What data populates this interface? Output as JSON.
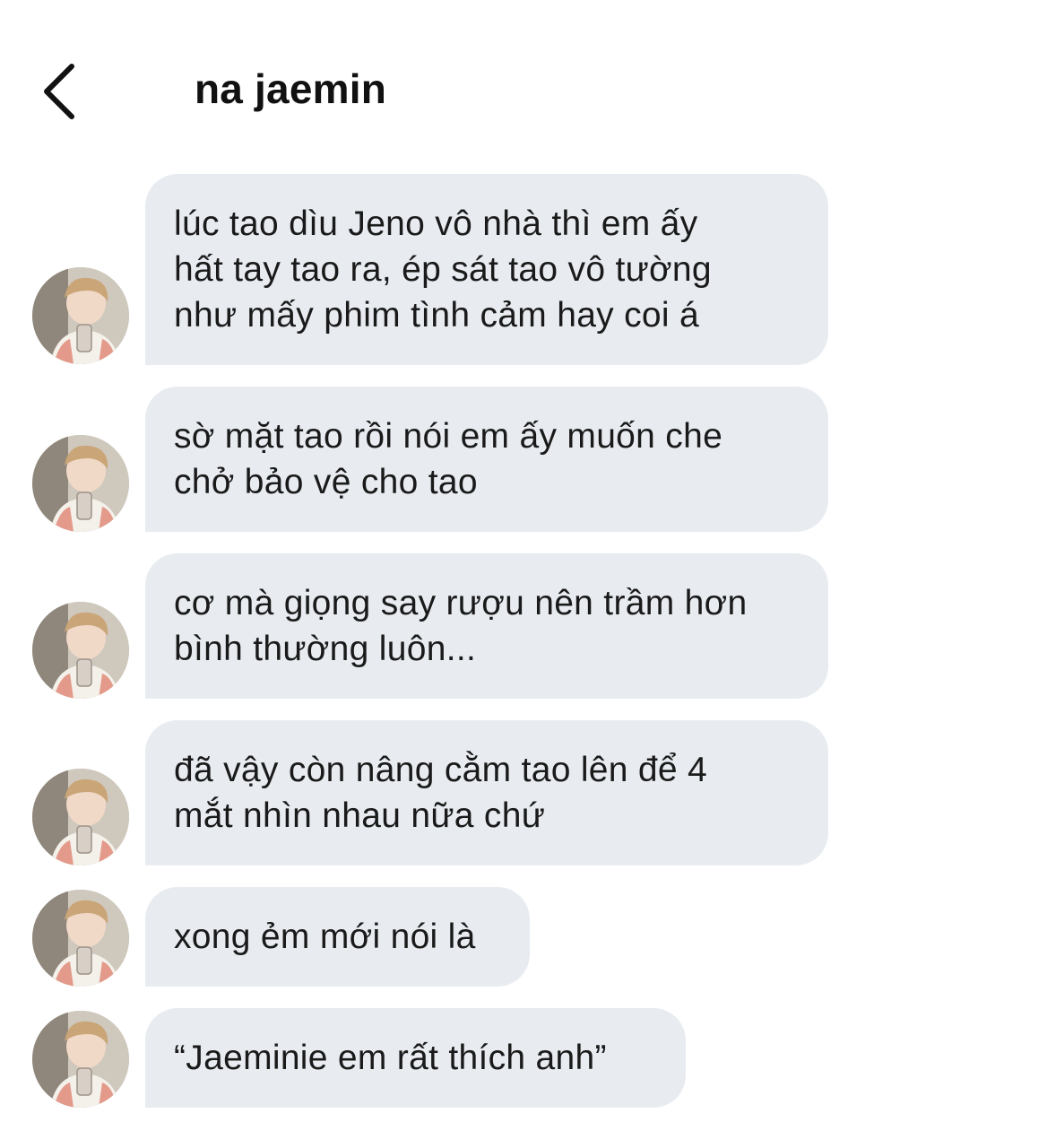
{
  "header": {
    "contact_name": "na jaemin",
    "back_icon": "chevron-left-icon"
  },
  "messages": [
    {
      "text": "lúc tao dìu Jeno vô nhà thì em ấy\nhất tay tao ra, ép sát tao vô tường\nnhư mấy phim tình cảm hay coi á"
    },
    {
      "text": "sờ mặt tao rồi nói em ấy muốn che\nchở bảo vệ cho tao"
    },
    {
      "text": "cơ mà giọng say rượu nên trầm hơn\nbình thường luôn..."
    },
    {
      "text": "đã vậy còn nâng cằm tao lên để 4\nmắt nhìn nhau nữa chứ"
    },
    {
      "text": "xong ẻm mới nói là"
    },
    {
      "text": "“Jaeminie em rất thích anh”"
    }
  ],
  "colors": {
    "bubble_background": "#e8ecf1",
    "text": "#111111",
    "page_background": "#ffffff"
  }
}
